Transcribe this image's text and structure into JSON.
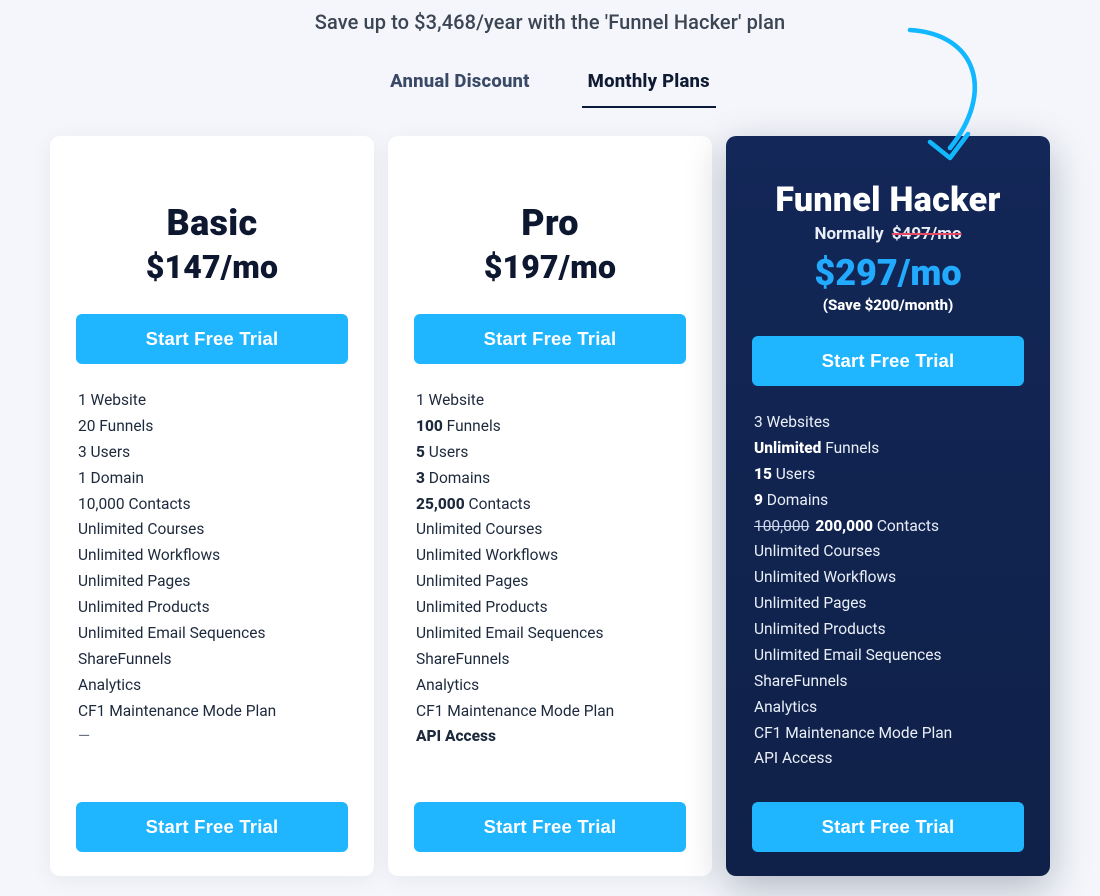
{
  "header": {
    "subhead": "Save up to $3,468/year with the 'Funnel Hacker' plan",
    "tabs": [
      {
        "id": "annual",
        "label": "Annual Discount",
        "active": false
      },
      {
        "id": "monthly",
        "label": "Monthly Plans",
        "active": true
      }
    ]
  },
  "cta_label": "Start Free Trial",
  "plans": [
    {
      "id": "basic",
      "variant": "light",
      "name": "Basic",
      "price_display": "$147/mo",
      "features": [
        {
          "text": "1 Website"
        },
        {
          "text": "20 Funnels"
        },
        {
          "text": "3 Users"
        },
        {
          "text": "1 Domain"
        },
        {
          "text": "10,000 Contacts"
        },
        {
          "text": "Unlimited Courses"
        },
        {
          "text": "Unlimited Workflows"
        },
        {
          "text": "Unlimited Pages"
        },
        {
          "text": "Unlimited Products"
        },
        {
          "text": "Unlimited Email Sequences"
        },
        {
          "text": "ShareFunnels"
        },
        {
          "text": "Analytics"
        },
        {
          "text": "CF1 Maintenance Mode Plan"
        },
        {
          "dash": "—"
        }
      ]
    },
    {
      "id": "pro",
      "variant": "light",
      "name": "Pro",
      "price_display": "$197/mo",
      "features": [
        {
          "text": "1 Website"
        },
        {
          "bold": "100",
          "text": " Funnels"
        },
        {
          "bold": "5",
          "text": " Users"
        },
        {
          "bold": "3",
          "text": " Domains"
        },
        {
          "bold": "25,000",
          "text": " Contacts"
        },
        {
          "text": "Unlimited Courses"
        },
        {
          "text": "Unlimited Workflows"
        },
        {
          "text": "Unlimited Pages"
        },
        {
          "text": "Unlimited Products"
        },
        {
          "text": "Unlimited Email Sequences"
        },
        {
          "text": "ShareFunnels"
        },
        {
          "text": "Analytics"
        },
        {
          "text": "CF1 Maintenance Mode Plan"
        },
        {
          "bold": "API Access"
        }
      ]
    },
    {
      "id": "funnel-hacker",
      "variant": "dark",
      "name": "Funnel Hacker",
      "normally_prefix": "Normally",
      "normally_strike": "$497/mo",
      "price_display": "$297/mo",
      "save_display": "(Save $200/month)",
      "features": [
        {
          "text": "3 Websites"
        },
        {
          "bold": "Unlimited",
          "text": " Funnels"
        },
        {
          "bold": "15",
          "text": " Users"
        },
        {
          "bold": "9",
          "text": " Domains"
        },
        {
          "strike": "100,000",
          "bold": "200,000",
          "text": " Contacts"
        },
        {
          "text": "Unlimited Courses"
        },
        {
          "text": "Unlimited Workflows"
        },
        {
          "text": "Unlimited Pages"
        },
        {
          "text": "Unlimited Products"
        },
        {
          "text": "Unlimited Email Sequences"
        },
        {
          "text": "ShareFunnels"
        },
        {
          "text": "Analytics"
        },
        {
          "text": "CF1 Maintenance Mode Plan"
        },
        {
          "text": "API Access"
        }
      ]
    }
  ]
}
